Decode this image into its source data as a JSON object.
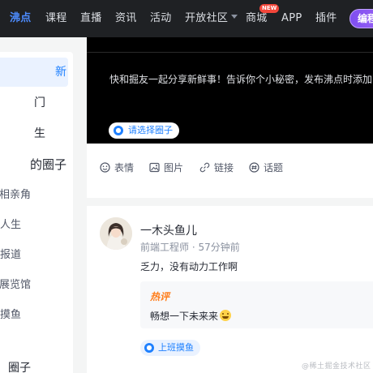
{
  "nav": {
    "items": [
      "沸点",
      "课程",
      "直播",
      "资讯",
      "活动",
      "开放社区",
      "商城",
      "APP",
      "插件"
    ],
    "active_index": 0,
    "new_badge": "NEW",
    "creator_button": "编程"
  },
  "sidebar": {
    "items": [
      "新",
      "门",
      "生",
      "的圈子",
      "相亲角",
      "人生",
      "报道",
      "展览馆",
      "摸鱼",
      "",
      "圈子"
    ],
    "active_index": 0
  },
  "composer": {
    "placeholder": "快和掘友一起分享新鲜事！告诉你个小秘密，发布沸点时添加圈子",
    "circle_button": "请选择圈子",
    "tools": {
      "emoji": "表情",
      "image": "图片",
      "link": "链接",
      "topic": "话题"
    }
  },
  "post": {
    "author": "一木头鱼儿",
    "title": "前端工程师",
    "separator": "·",
    "time": "57分钟前",
    "content": "乏力，没有动力工作啊",
    "hot_label": "热评",
    "hot_comment": "畅想一下未来来",
    "circle_tag": "上班摸鱼"
  },
  "watermark": "@稀土掘金技术社区",
  "colors": {
    "topbar": "#1f2124",
    "accent": "#1e80ff",
    "hot": "#ff7d1a",
    "creator": "#8a55f2"
  }
}
